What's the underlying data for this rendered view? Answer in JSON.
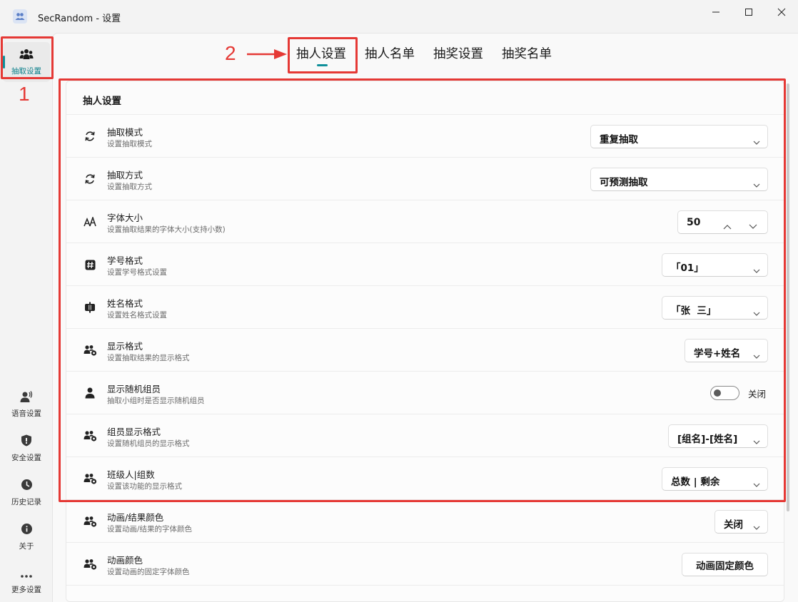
{
  "window": {
    "title": "SecRandom - 设置",
    "minimize_icon": "minimize-icon",
    "maximize_icon": "maximize-icon",
    "close_icon": "close-icon"
  },
  "sidebar": {
    "top_items": [
      {
        "label": "抽取设置",
        "icon": "people-group-icon",
        "active": true
      }
    ],
    "bottom_items": [
      {
        "label": "语音设置",
        "icon": "voice-icon"
      },
      {
        "label": "安全设置",
        "icon": "shield-icon"
      },
      {
        "label": "历史记录",
        "icon": "history-icon"
      },
      {
        "label": "关于",
        "icon": "info-icon"
      },
      {
        "label": "更多设置",
        "icon": "more-icon"
      }
    ]
  },
  "tabs": [
    {
      "label": "抽人设置",
      "active": true
    },
    {
      "label": "抽人名单"
    },
    {
      "label": "抽奖设置"
    },
    {
      "label": "抽奖名单"
    }
  ],
  "card": {
    "title": "抽人设置",
    "rows": [
      {
        "title": "抽取模式",
        "desc": "设置抽取模式",
        "icon": "sync-icon",
        "control": "dropdown",
        "value": "重复抽取"
      },
      {
        "title": "抽取方式",
        "desc": "设置抽取方式",
        "icon": "sync-icon",
        "control": "dropdown",
        "value": "可预测抽取"
      },
      {
        "title": "字体大小",
        "desc": "设置抽取结果的字体大小(支持小数)",
        "icon": "font-size-icon",
        "control": "spinbox",
        "value": "50"
      },
      {
        "title": "学号格式",
        "desc": "设置学号格式设置",
        "icon": "hash-icon",
        "control": "dropdown",
        "value": "「01」"
      },
      {
        "title": "姓名格式",
        "desc": "设置姓名格式设置",
        "icon": "name-format-icon",
        "control": "dropdown",
        "value": "「张  三」"
      },
      {
        "title": "显示格式",
        "desc": "设置抽取结果的显示格式",
        "icon": "people-view-icon",
        "control": "dropdown",
        "value": "学号+姓名"
      },
      {
        "title": "显示随机组员",
        "desc": "抽取小组时是否显示随机组员",
        "icon": "person-icon",
        "control": "toggle",
        "value": "关闭"
      },
      {
        "title": "组员显示格式",
        "desc": "设置随机组员的显示格式",
        "icon": "people-view-icon",
        "control": "dropdown",
        "value": "[组名]-[姓名]"
      },
      {
        "title": "班级人|组数",
        "desc": "设置该功能的显示格式",
        "icon": "people-view-icon",
        "control": "dropdown",
        "value": "总数 | 剩余"
      },
      {
        "title": "动画/结果颜色",
        "desc": "设置动画/结果的字体颜色",
        "icon": "people-view-icon",
        "control": "dropdown",
        "value": "关闭"
      },
      {
        "title": "动画颜色",
        "desc": "设置动画的固定字体颜色",
        "icon": "people-view-icon",
        "control": "button",
        "value": "动画固定颜色"
      }
    ]
  },
  "annotations": [
    {
      "number": "1"
    },
    {
      "number": "2"
    }
  ],
  "colors": {
    "accent": "#0f8f9a",
    "annotation_red": "#e53935"
  }
}
